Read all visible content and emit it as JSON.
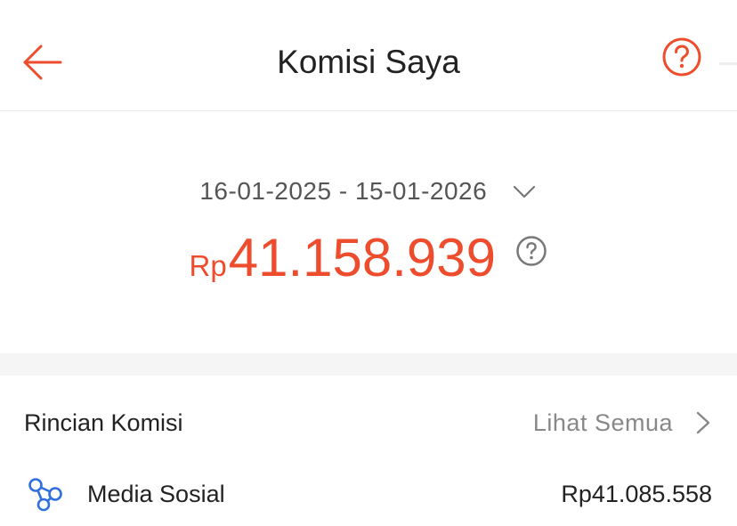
{
  "header": {
    "title": "Komisi Saya",
    "back_icon": "arrow-left-icon",
    "help_icon": "question-circle-icon"
  },
  "summary": {
    "date_range": "16-01-2025 - 15-01-2026",
    "currency": "Rp",
    "amount": "41.158.939"
  },
  "breakdown": {
    "title": "Rincian Komisi",
    "see_all_label": "Lihat Semua",
    "items": [
      {
        "label": "Media Sosial",
        "value": "Rp41.085.558",
        "icon": "share-network-icon"
      }
    ]
  },
  "colors": {
    "accent": "#ee4d2d",
    "text_primary": "#222222",
    "text_secondary": "#888888",
    "icon_blue": "#2f6fde",
    "divider": "#f5f5f5"
  }
}
